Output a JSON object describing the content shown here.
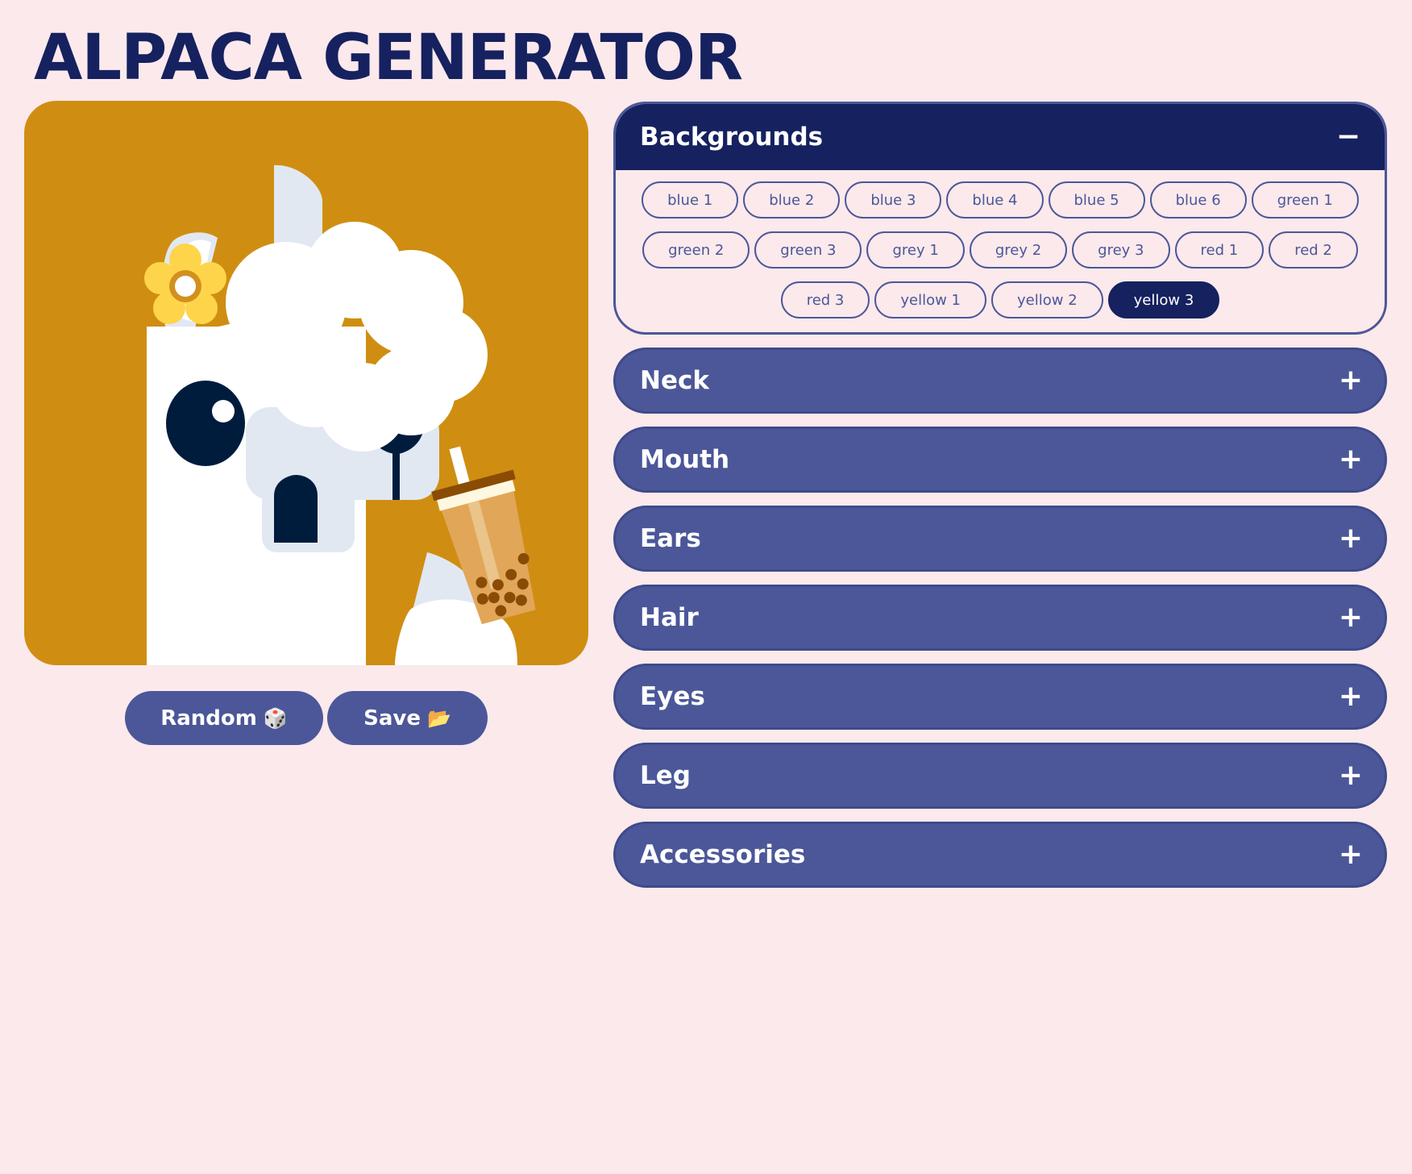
{
  "app": {
    "title": "ALPACA GENERATOR"
  },
  "actions": {
    "random_label": "Random",
    "random_icon": "🎲",
    "save_label": "Save",
    "save_icon": "📂"
  },
  "preview": {
    "background_color": "#cf8e12",
    "accessory": "bubble-tea",
    "hair_accessory": "flower"
  },
  "sections": [
    {
      "label": "Backgrounds",
      "expanded": true,
      "toggle": "−",
      "options": [
        "blue 1",
        "blue 2",
        "blue 3",
        "blue 4",
        "blue 5",
        "blue 6",
        "green 1",
        "green 2",
        "green 3",
        "grey 1",
        "grey 2",
        "grey 3",
        "red 1",
        "red 2",
        "red 3",
        "yellow 1",
        "yellow 2",
        "yellow 3"
      ],
      "selected": "yellow 3"
    },
    {
      "label": "Neck",
      "expanded": false,
      "toggle": "+"
    },
    {
      "label": "Mouth",
      "expanded": false,
      "toggle": "+"
    },
    {
      "label": "Ears",
      "expanded": false,
      "toggle": "+"
    },
    {
      "label": "Hair",
      "expanded": false,
      "toggle": "+"
    },
    {
      "label": "Eyes",
      "expanded": false,
      "toggle": "+"
    },
    {
      "label": "Leg",
      "expanded": false,
      "toggle": "+"
    },
    {
      "label": "Accessories",
      "expanded": false,
      "toggle": "+"
    }
  ],
  "colors": {
    "page_bg": "#fbe9ec",
    "navy": "#16215f",
    "accent": "#4b5798"
  }
}
